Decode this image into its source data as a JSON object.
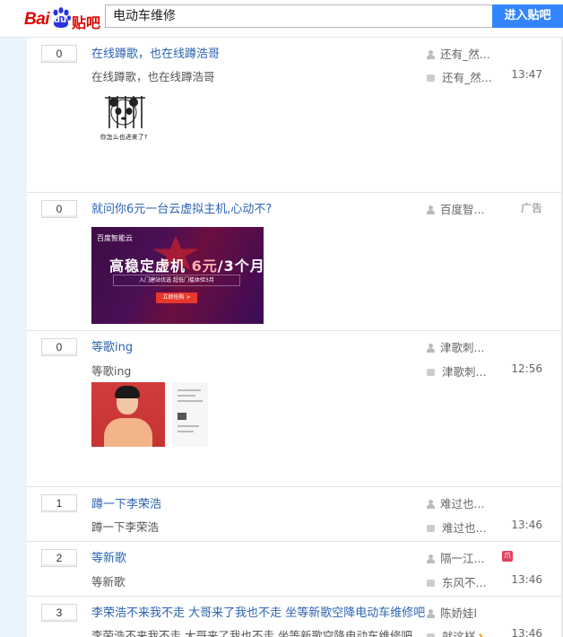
{
  "header": {
    "logo_text": "Bai",
    "logo_du": "du",
    "logo_tieba": "贴吧",
    "search_value": "电动车维修",
    "enter_button": "进入贴吧"
  },
  "threads": [
    {
      "reply_count": "0",
      "title": "在线蹲歌，也在线蹲浩哥",
      "abstract": "在线蹲歌，也在线蹲浩哥",
      "author": "还有_然...",
      "last_reply": "还有_然...",
      "time": "13:47",
      "image_caption": "你怎么也进来了?"
    },
    {
      "reply_count": "0",
      "title": "就问你6元一台云虚拟主机,心动不?",
      "author": "百度智...",
      "tag": "广告",
      "ad": {
        "brand": "百度智能云",
        "headline_a": "高稳定虚机",
        "headline_price": "6元",
        "headline_b": "/3个月",
        "sub": "入门建站优选  超低门槛体验3月",
        "cta": "立即抢购 >"
      }
    },
    {
      "reply_count": "0",
      "title": "等歌ing",
      "abstract": "等歌ing",
      "author": "津歌刺...",
      "last_reply": "津歌刺...",
      "time": "12:56"
    },
    {
      "reply_count": "1",
      "title": "蹲一下李荣浩",
      "abstract": "蹲一下李荣浩",
      "author": "难过也...",
      "last_reply": "难过也...",
      "time": "13:46"
    },
    {
      "reply_count": "2",
      "title": "等新歌",
      "abstract": "等新歌",
      "author": "隔一江...",
      "badge": "爪",
      "last_reply": "东风不...",
      "time": "13:46"
    },
    {
      "reply_count": "3",
      "title": "李荣浩不来我不走 大哥来了我也不走 坐等新歌空降电动车维修吧",
      "abstract": "李荣浩不来我不走 大哥来了我也不走 坐等新歌空降电动车维修吧",
      "author": "陈娇娃l",
      "last_reply": "就这样",
      "time": "13:46"
    }
  ]
}
